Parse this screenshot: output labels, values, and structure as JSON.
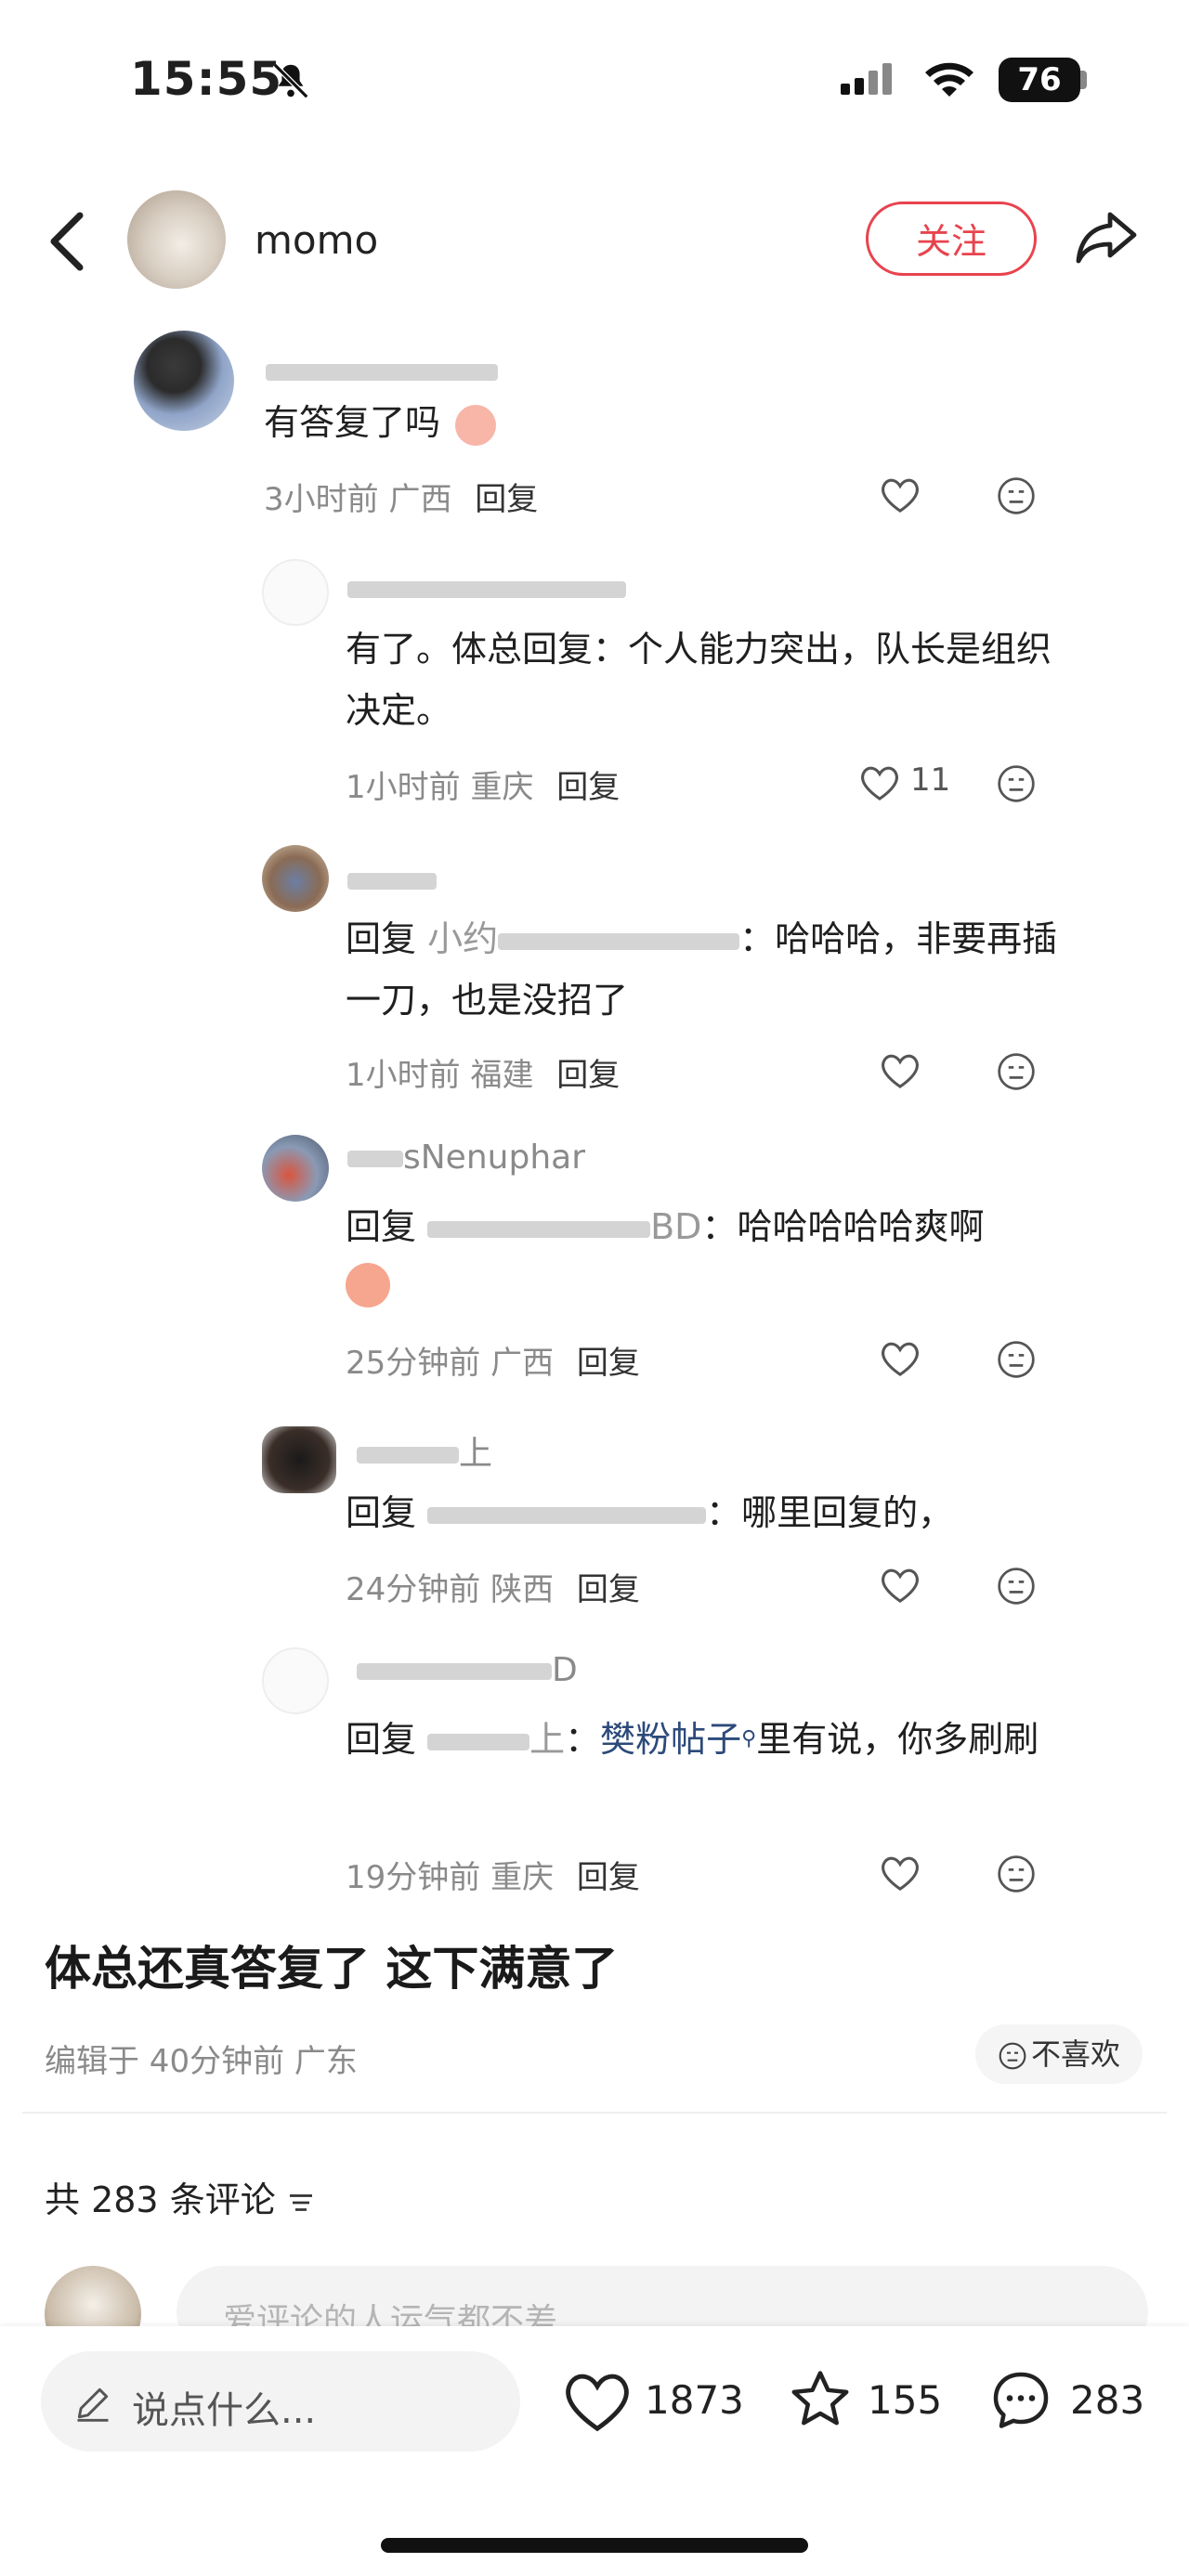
{
  "status": {
    "time": "15:55",
    "battery": "76"
  },
  "nav": {
    "username": "momo",
    "follow_label": "关注"
  },
  "comments": [
    {
      "name_visible": "",
      "text": "有答复了吗",
      "time": "3小时前",
      "location": "广西",
      "reply_label": "回复",
      "likes": ""
    },
    {
      "name_visible": "",
      "text": "有了。体总回复：个人能力突出，队长是组织决定。",
      "time": "1小时前",
      "location": "重庆",
      "reply_label": "回复",
      "likes": "11"
    },
    {
      "name_visible": "",
      "reply_prefix": "回复",
      "reply_to": "小约",
      "text": "：哈哈哈，非要再插一刀，也是没招了",
      "time": "1小时前",
      "location": "福建",
      "reply_label": "回复",
      "likes": ""
    },
    {
      "name_visible": "sNenuphar",
      "reply_prefix": "回复",
      "reply_to": "BD",
      "text": "：哈哈哈哈哈爽啊",
      "time": "25分钟前",
      "location": "广西",
      "reply_label": "回复",
      "likes": ""
    },
    {
      "name_visible": "上",
      "reply_prefix": "回复",
      "reply_to": "",
      "text": "：哪里回复的，",
      "time": "24分钟前",
      "location": "陕西",
      "reply_label": "回复",
      "likes": ""
    },
    {
      "name_visible": "D",
      "reply_prefix": "回复",
      "reply_to": "上",
      "text_before_link": "：",
      "link": "樊粉帖子",
      "text": "里有说，你多刷刷",
      "time": "19分钟前",
      "location": "重庆",
      "reply_label": "回复",
      "likes": ""
    }
  ],
  "post": {
    "title": "体总还真答复了 这下满意了",
    "edited": "编辑于 40分钟前 广东",
    "dislike": "不喜欢",
    "total_comments": "共 283 条评论",
    "comment_placeholder": "爱评论的人运气都不差"
  },
  "bottom": {
    "say_placeholder": "说点什么...",
    "likes": "1873",
    "stars": "155",
    "comments": "283"
  },
  "colors": {
    "accent": "#e8434e",
    "link": "#2c4a7a",
    "meta": "#8a8a8a"
  }
}
